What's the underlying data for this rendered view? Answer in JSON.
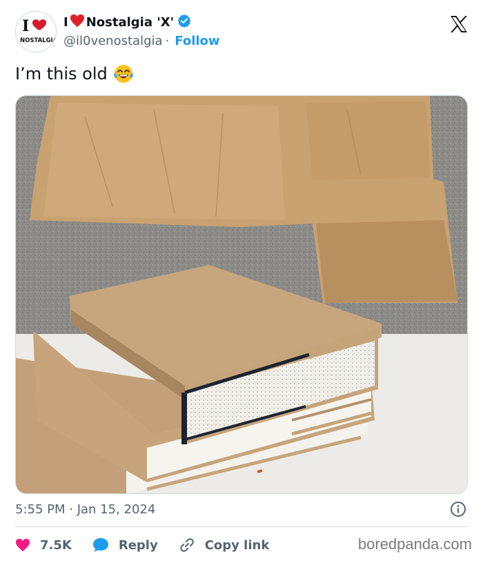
{
  "author": {
    "name_prefix": "I",
    "name_suffix": "Nostalgia 'X'",
    "handle": "@il0venostalgia",
    "follow_label": "Follow",
    "avatar_text_top": "I",
    "avatar_text_bottom": "NOSTALGIA"
  },
  "tweet": {
    "text": "I’m this old",
    "emoji": "face-with-tears-of-joy"
  },
  "meta": {
    "timestamp": "5:55 PM · Jan 15, 2024"
  },
  "actions": {
    "likes": "7.5K",
    "reply_label": "Reply",
    "copy_link_label": "Copy link"
  },
  "watermark": "boredpanda.com",
  "colors": {
    "accent": "#1d9bf0",
    "heart": "#f91880",
    "muted": "#536471",
    "text": "#0f1419"
  }
}
